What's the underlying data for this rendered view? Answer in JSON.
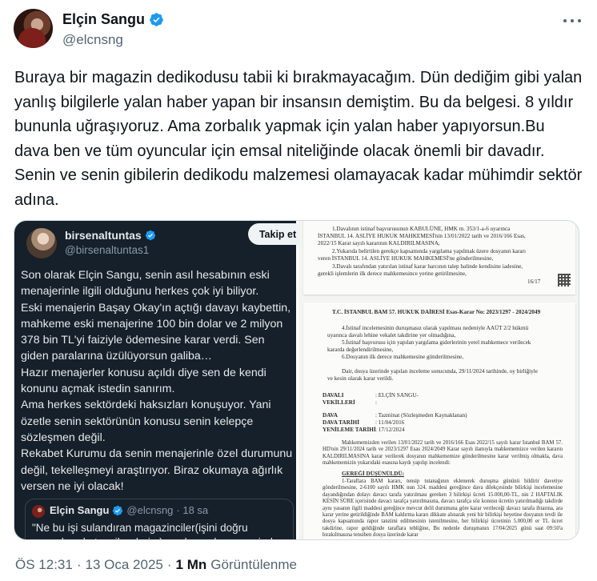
{
  "author": {
    "name": "Elçin Sangu",
    "handle": "@elcnsng"
  },
  "tweet_text": "Buraya bir magazin dedikodusu tabii ki bırakmayacağım. Dün dediğim gibi yalan yanlış bilgilerle yalan haber yapan bir insansın demiştim. Bu da belgesi. 8 yıldır bununla uğraşıyoruz. Ama zorbalık yapmak için yalan haber yapıyorsun.Bu dava ben ve tüm oyuncular için emsal niteliğinde olacak önemli bir davadır. Senin ve senin gibilerin dedikodu malzemesi olamayacak kadar mühimdir sektör adına.",
  "quoted": {
    "name": "birsenaltuntas",
    "handle": "@birsenaltuntas1",
    "follow_label": "Takip et",
    "text": "Son olarak Elçin Sangu, senin asıl hesabının eski menajerinle ilgili olduğunu herkes çok iyi biliyor.\nEski menajerin Başay Okay'ın açtığı davayı kaybettin, mahkeme eski menajerine 100 bin dolar ve 2 milyon 378 bin TL'yi faiziyle ödemesine karar verdi. Sen giden paralarına üzülüyorsun galiba…\nHazır menajerler konusu açıldı diye sen de kendi konunu açmak istedin sanırım.\nAma herkes sektördeki haksızları konuşuyor. Yani özetle senin sektörünün konusu senin kelepçe sözleşmen değil.\nRekabet Kurumu da senin menajerinle özel durumunu değil, tekelleşmeyi araştırıyor. Biraz okumaya ağırlık versen ne iyi olacak!",
    "nested": {
      "name": "Elçin Sangu",
      "handle": "@elcnsng",
      "time": "· 18 sa",
      "text": "\"Ne bu işi sulandıran magazinciler(işini doğru yapanları da tenzih ederim) ne de ... olan menajerler"
    }
  },
  "document": {
    "page1": [
      "1.Davalının istinaf başvurusunun KABULÜNE, HMK m. 353/1-a-6 uyarınca",
      "İSTANBUL 14. ASLİYE HUKUK MAHKEMESİ'nin 13/01/2022 tarih ve 2016/166 Esas,",
      "2022/15 Karar sayılı kararının KALDIRILMASINA,",
      "2.Yukarıda belirtilen gerekçe kapsamında yargılama yapılmak üzere dosyanın kararı",
      "veren İSTANBUL 14. ASLİYE HUKUK MAHKEMESİ'ne gönderilmesine,",
      "3.Davalı tarafından yatırılan istinaf karar harcının talep halinde kendisine iadesine,",
      "gerekli işlemlerin ilk derece mahkemesince yerine getirilmesine,"
    ],
    "page1_footer": "16/17",
    "page2_header": "T.C. İSTANBUL BAM 57. HUKUK DAİRESİ Esas-Karar No: 2023/1297 - 2024/2049",
    "page2_intro": [
      "4.İstinaf incelemesinin duruşmasız olarak yapılması nedeniyle AAÜT 2/2 hükmü",
      "uyarınca davalı lehine vekalet takdirine yer olmadığına,",
      "5.İstinaf başvurusu için yapılan yargılama giderlerinin yerel mahkemece verilecek",
      "kararda değerlendirilmesine,",
      "6.Dosyanın ilk derece mahkemesine gönderilmesine,",
      "Dair, dosya üzerinde yapılan inceleme sonucunda, 29/11/2024 tarihinde, oy birliğiyle",
      "ve kesin olarak karar verildi."
    ],
    "fields": [
      {
        "label": "DAVALI",
        "value": ": ELÇİN SANGU-"
      },
      {
        "label": "VEKİLLERİ",
        "value": ":"
      },
      {
        "label": "DAVA",
        "value": ": Tazminat (Sözleşmeden Kaynaklanan)"
      },
      {
        "label": "DAVA TARİHİ",
        "value": ": 11/04/2016"
      },
      {
        "label": "YENİLEME TARİHİ",
        "value": ": 17/12/2024"
      }
    ],
    "body": "Mahkememizden verilen 13/01/2022 tarih ve 2016/166 Esas 2022/15 sayılı karar İstanbul BAM 57. HD'nin 29/11/2024 tarih ve 2023/1297 Esas 2024/2049 Karar sayılı ilamıyla mahkememizce verilen kararın KALDIRILMASINA karar verilerek dosyanın mahkememize gönderilmesine karar verilmiş olmakla, dava mahkememizin yukarıdaki esasına kaydı yapılıp incelendi:",
    "gereği": "GEREĞİ DÜŞÜNÜLDÜ:",
    "body2": "1-Taraflara BAM kararı, tensip tutanağının eklenerek duruşma gününü bildirir davetiye gönderilmesine, 2-6100 sayılı HMK nun 324. maddesi gereğince dava dilekçesinde bilirkişi incelemesine dayandığından dolayı davacı tarafa yatırılması gereken 3 bilirkişi ücreti 15.000,00-TL, nin 2 HAFTALIK KESİN SÜRE içerisinde davacı tarafça yatırılmasına, davacı tarafça söz konusu ücretin yatırılmadığı takdirde aynı yasanın ilgili maddesi gereğince mevcut delil durumuna göre karar verileceği davacı tarafa ihtarına, ara karar yerine getirildiğinde BAM kaldırma kararı dikkate alınarak yeni bir bilirkişi heyetine dosyanın tevdi ile dosya kapsamında rapor tanzimi edilmesinin istenilmesine, her bilirkişi ücretinin 5.000,00 er TL ücret takdirine, rapor geldiğinde taraflara tebliğine, Bu nedenle duruşmanın 17/04/2025 günü saat 09:50'a bırakılmasına tensiben dosya üzerinde karar"
  },
  "meta": {
    "time": "ÖS 12:31",
    "sep": "·",
    "date": "13 Oca 2025",
    "views_count": "1 Mn",
    "views_label": "Görüntülenme"
  },
  "colors": {
    "verified": "#1d9bf0",
    "text": "#0f1419",
    "secondary": "#536471",
    "dark_bg": "#15202b"
  }
}
